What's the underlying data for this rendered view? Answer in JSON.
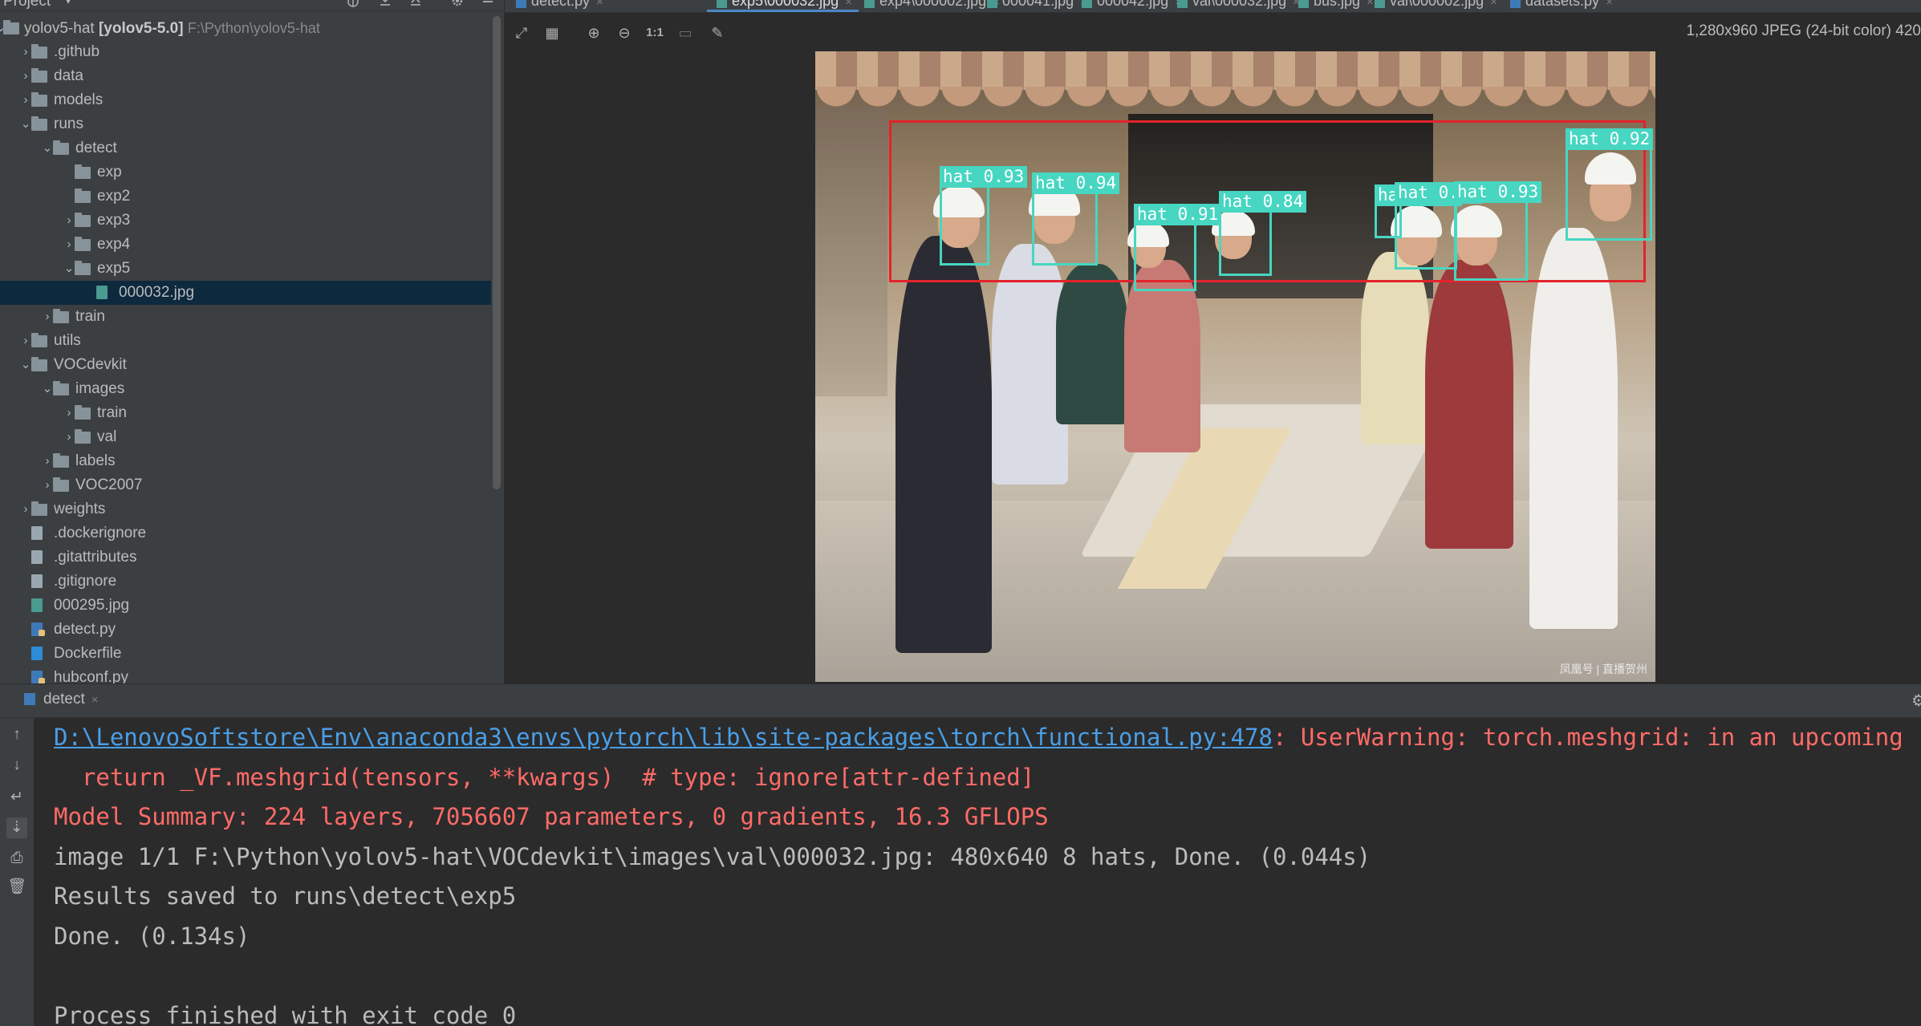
{
  "project": {
    "title": "Project",
    "tree": [
      {
        "depth": 0,
        "arrow": "open",
        "icon": "folder",
        "label": "yolov5-hat",
        "bold": "[yolov5-5.0]",
        "path": "F:\\Python\\yolov5-hat"
      },
      {
        "depth": 1,
        "arrow": "closed",
        "icon": "folder",
        "label": ".github"
      },
      {
        "depth": 1,
        "arrow": "closed",
        "icon": "folder",
        "label": "data"
      },
      {
        "depth": 1,
        "arrow": "closed",
        "icon": "folder",
        "label": "models"
      },
      {
        "depth": 1,
        "arrow": "open",
        "icon": "folder",
        "label": "runs"
      },
      {
        "depth": 2,
        "arrow": "open",
        "icon": "folder",
        "label": "detect"
      },
      {
        "depth": 3,
        "arrow": "none",
        "icon": "folder",
        "label": "exp"
      },
      {
        "depth": 3,
        "arrow": "none",
        "icon": "folder",
        "label": "exp2"
      },
      {
        "depth": 3,
        "arrow": "closed",
        "icon": "folder",
        "label": "exp3"
      },
      {
        "depth": 3,
        "arrow": "closed",
        "icon": "folder",
        "label": "exp4"
      },
      {
        "depth": 3,
        "arrow": "open",
        "icon": "folder",
        "label": "exp5"
      },
      {
        "depth": 4,
        "arrow": "none",
        "icon": "img",
        "label": "000032.jpg",
        "selected": true
      },
      {
        "depth": 2,
        "arrow": "closed",
        "icon": "folder",
        "label": "train"
      },
      {
        "depth": 1,
        "arrow": "closed",
        "icon": "folder",
        "label": "utils"
      },
      {
        "depth": 1,
        "arrow": "open",
        "icon": "folder",
        "label": "VOCdevkit"
      },
      {
        "depth": 2,
        "arrow": "open",
        "icon": "folder",
        "label": "images"
      },
      {
        "depth": 3,
        "arrow": "closed",
        "icon": "folder",
        "label": "train"
      },
      {
        "depth": 3,
        "arrow": "closed",
        "icon": "folder",
        "label": "val"
      },
      {
        "depth": 2,
        "arrow": "closed",
        "icon": "folder",
        "label": "labels"
      },
      {
        "depth": 2,
        "arrow": "closed",
        "icon": "folder",
        "label": "VOC2007"
      },
      {
        "depth": 1,
        "arrow": "closed",
        "icon": "folder",
        "label": "weights"
      },
      {
        "depth": 1,
        "arrow": "none",
        "icon": "file",
        "label": ".dockerignore"
      },
      {
        "depth": 1,
        "arrow": "none",
        "icon": "file",
        "label": ".gitattributes"
      },
      {
        "depth": 1,
        "arrow": "none",
        "icon": "file",
        "label": ".gitignore"
      },
      {
        "depth": 1,
        "arrow": "none",
        "icon": "img",
        "label": "000295.jpg"
      },
      {
        "depth": 1,
        "arrow": "none",
        "icon": "py",
        "label": "detect.py"
      },
      {
        "depth": 1,
        "arrow": "none",
        "icon": "docker",
        "label": "Dockerfile"
      },
      {
        "depth": 1,
        "arrow": "none",
        "icon": "py",
        "label": "hubconf.py"
      }
    ]
  },
  "editor": {
    "tabs": [
      {
        "label": "detect.py",
        "icon": "py"
      },
      {
        "label": "exp5\\000032.jpg",
        "icon": "img",
        "active": true
      },
      {
        "label": "exp4\\000002.jpg",
        "icon": "img"
      },
      {
        "label": "000041.jpg",
        "icon": "img"
      },
      {
        "label": "000042.jpg",
        "icon": "img"
      },
      {
        "label": "val\\000032.jpg",
        "icon": "img"
      },
      {
        "label": "bus.jpg",
        "icon": "img"
      },
      {
        "label": "val\\000002.jpg",
        "icon": "img"
      },
      {
        "label": "datasets.py",
        "icon": "py"
      }
    ],
    "image_info": "1,280x960 JPEG (24-bit color) 420",
    "toolbar": {
      "actual_size": "1:1"
    },
    "detections": [
      {
        "label": "hat 0.93"
      },
      {
        "label": "hat 0.94"
      },
      {
        "label": "hat 0.91"
      },
      {
        "label": "hat 0.84"
      },
      {
        "label": "hat 0.75"
      },
      {
        "label": "hat 0.94"
      },
      {
        "label": "hat 0.93"
      },
      {
        "label": "hat 0.92"
      }
    ],
    "watermark": "凤凰号 | 直播贺州"
  },
  "run": {
    "tab_label": "detect",
    "lines": [
      {
        "type": "err-link",
        "link": "D:\\LenovoSoftstore\\Env\\anaconda3\\envs\\pytorch\\lib\\site-packages\\torch\\functional.py:478",
        "text": ": UserWarning: torch.meshgrid: in an upcoming"
      },
      {
        "type": "err",
        "text": "  return _VF.meshgrid(tensors, **kwargs)  # type: ignore[attr-defined]"
      },
      {
        "type": "err",
        "text": "Model Summary: 224 layers, 7056607 parameters, 0 gradients, 16.3 GFLOPS"
      },
      {
        "type": "out",
        "text": "image 1/1 F:\\Python\\yolov5-hat\\VOCdevkit\\images\\val\\000032.jpg: 480x640 8 hats, Done. (0.044s)"
      },
      {
        "type": "out",
        "text": "Results saved to runs\\detect\\exp5"
      },
      {
        "type": "out",
        "text": "Done. (0.134s)"
      },
      {
        "type": "out",
        "text": ""
      },
      {
        "type": "out",
        "text": "Process finished with exit code 0"
      }
    ]
  },
  "colors": {
    "detection_box": "#47d6c1",
    "group_box": "#e3232c",
    "error_text": "#ff6b68",
    "link": "#4a9ee6"
  }
}
